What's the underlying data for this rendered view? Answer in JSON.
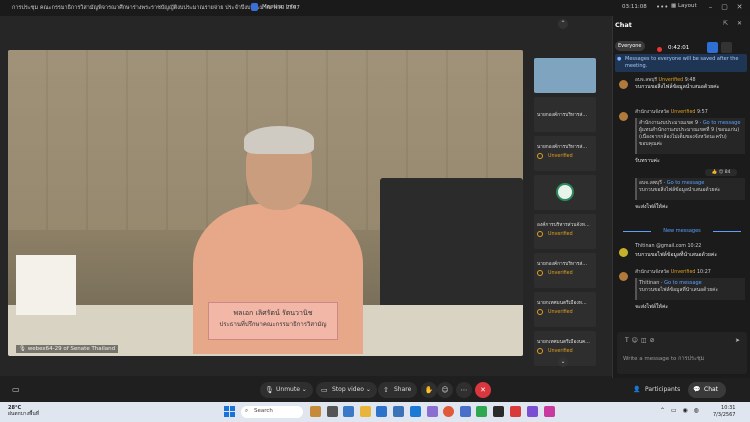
{
  "titlebar": {
    "meeting_title": "การประชุม คณะกรรมาธิการวิสามัญพิจารณาศึกษาร่างพระราชบัญญัติงบประมาณรายจ่าย ประจำปีงบประมาณ พ.ศ. 2567",
    "meeting_info": "Meeting info",
    "clock": "03:11:08",
    "layout": "Layout"
  },
  "video": {
    "nameplate_line1": "พลเอก เลิศรัตน์ รัตนวานิช",
    "nameplate_line2": "ประธานที่ปรึกษาคณะกรรมาธิการวิสามัญ",
    "label": "webex64-29 of Senate Thailand"
  },
  "tiles": [
    {
      "name": "",
      "status": "",
      "kind": "thumb"
    },
    {
      "name": "นายกองค์การบริหารส่…",
      "status": "",
      "kind": "name"
    },
    {
      "name": "นายกองค์การบริหารส่…",
      "status": "Unverified",
      "kind": "status"
    },
    {
      "name": "",
      "status": "",
      "kind": "logo"
    },
    {
      "name": "องค์การบริหารส่วนจังห…",
      "status": "Unverified",
      "kind": "status"
    },
    {
      "name": "นายกองค์การบริหารส่…",
      "status": "Unverified",
      "kind": "status"
    },
    {
      "name": "นายกเทศมนตรีเมืองห…",
      "status": "Unverified",
      "kind": "status"
    },
    {
      "name": "นายกเทศมนตรีเมืองนค…",
      "status": "Unverified",
      "kind": "status"
    }
  ],
  "controls": {
    "unmute": "Unmute",
    "stop_video": "Stop video",
    "share": "Share",
    "participants": "Participants",
    "chat": "Chat"
  },
  "chat": {
    "title": "Chat",
    "everyone": "Everyone",
    "rec_time": "0:42:01",
    "notice": "Messages to everyone will be saved after the meeting.",
    "messages": [
      {
        "sender": "อบจ.ลพบุรี",
        "status": "Unverified",
        "time": "9:48",
        "body": "รบกวนขอสิ่งไฟล์ข้อมูลนำเสนอด้วยค่ะ"
      },
      {
        "sender": "สำนักงานจังหวัด",
        "status": "Unverified",
        "time": "9:57",
        "quote_sender": "สำนักงานงบประมาณเขต 9",
        "quote_link": "Go to message",
        "quote_body": "ผู้แทนสำนักงานงบประมาณเขตที่ 9 (ขอนแก่น) (เนื่องจากกล้องไม่เต็มของจังหวัดนะครับ) ขอบคุณค่ะ",
        "reply": "รับทราบค่ะ",
        "quote2_sender": "อบจ.ลพบุรี",
        "quote2_link": "Go to message",
        "quote2_body": "รบกวนขอสิ่งไฟล์ข้อมูลนำเสนอด้วยค่ะ",
        "reply2": "จะส่งไฟล์ให้ค่ะ",
        "reacts": "👍 😊 84"
      },
      {
        "sender": "Thitinan",
        "email": "@gmail.com",
        "time": "10:22",
        "body": "รบกวนขอไฟล์ข้อมูลที่นำเสนอด้วยค่ะ"
      },
      {
        "sender": "สำนักงานจังหวัด",
        "status": "Unverified",
        "time": "10:27",
        "quote_sender": "Thitinan",
        "quote_link": "Go to message",
        "quote_body": "รบกวนขอไฟล์ข้อมูลที่นำเสนอด้วยค่ะ",
        "reply": "จะส่งไฟล์ให้ค่ะ"
      }
    ],
    "new_messages": "New messages",
    "composer_placeholder": "Write a message to การประชุม"
  },
  "taskbar": {
    "temp": "28°C",
    "weather": "ฝนตกบางพื้นที่",
    "search": "Search",
    "time": "10:31",
    "date": "7/3/2567"
  },
  "colors": {
    "accent": "#2d6fd2",
    "unverified": "#e0a020",
    "end_call": "#d9363e"
  }
}
